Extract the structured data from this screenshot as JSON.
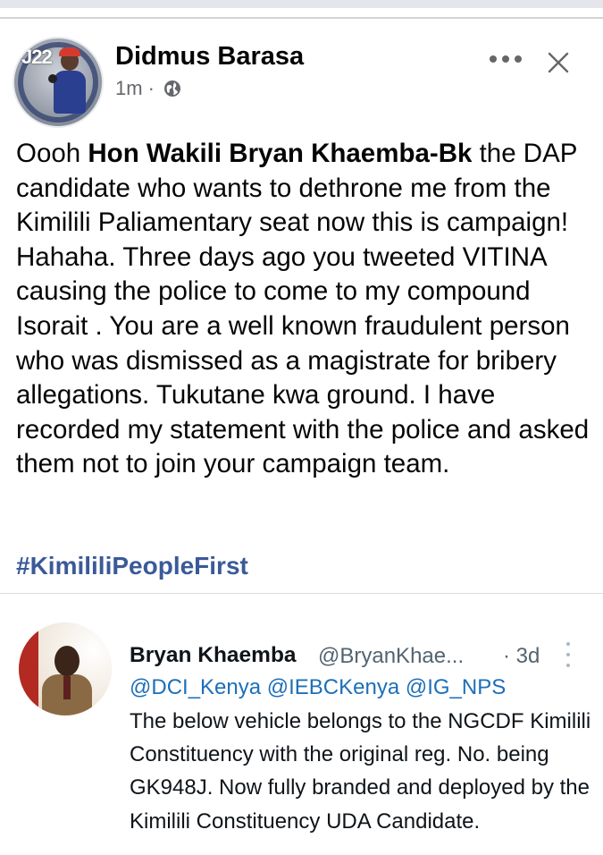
{
  "post": {
    "author": "Didmus Barasa",
    "time": "1m",
    "separator": "·",
    "privacy_icon": "globe-icon",
    "more_icon": "more-horizontal-icon",
    "close_icon": "close-icon",
    "body": {
      "intro": "Oooh ",
      "tagged_name": "Hon Wakili Bryan Khaemba-Bk",
      "rest": "  the DAP candidate who wants to dethrone me from the Kimilili Paliamentary seat now this is campaign! Hahaha.  Three days ago you tweeted VITINA causing the police to come to my compound Isorait . You are a well known fraudulent person who was dismissed as a magistrate for bribery allegations. Tukutane kwa ground. I have recorded my statement with the police and asked them not to join your campaign team."
    },
    "hashtag": "#KimililiPeopleFirst"
  },
  "shared_tweet": {
    "name": "Bryan Khaemba",
    "handle": "@BryanKhae...",
    "time": "· 3d",
    "mentions": "@DCI_Kenya @IEBCKenya @IG_NPS",
    "text": "The below vehicle belongs to the NGCDF Kimilili Constituency with the original reg. No. being GK948J. Now fully branded and deployed by the Kimilili Constituency UDA Candidate."
  },
  "colors": {
    "text": "#050505",
    "secondary": "#65676b",
    "hashtag": "#3a5a98",
    "mention": "#1d6fb8"
  }
}
